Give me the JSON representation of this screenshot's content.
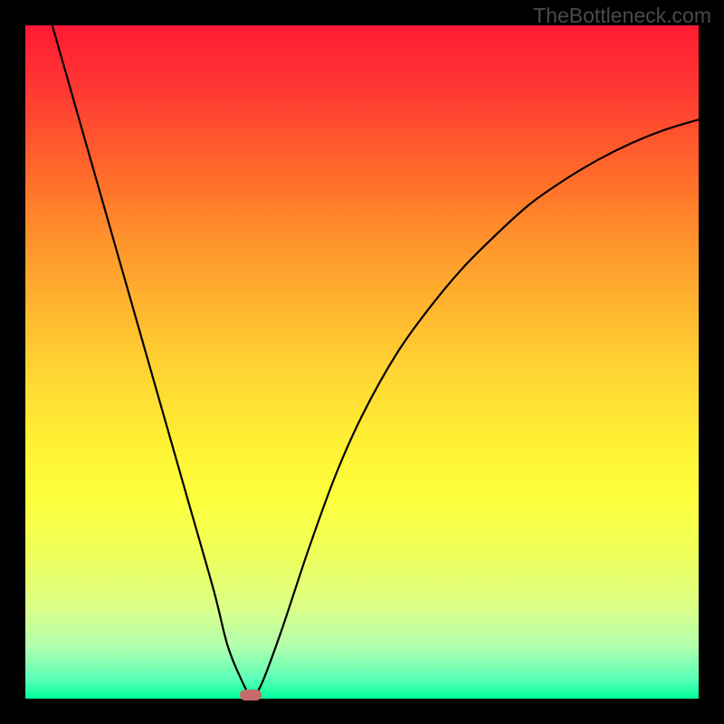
{
  "watermark": "TheBottleneck.com",
  "chart_data": {
    "type": "line",
    "title": "",
    "xlabel": "",
    "ylabel": "",
    "xlim": [
      0,
      100
    ],
    "ylim": [
      0,
      100
    ],
    "series": [
      {
        "name": "curve",
        "x": [
          4,
          8,
          12,
          16,
          20,
          24,
          28,
          30,
          32,
          33.5,
          35,
          38,
          42,
          46,
          50,
          55,
          60,
          65,
          70,
          75,
          80,
          85,
          90,
          95,
          100
        ],
        "y": [
          100,
          86,
          72,
          58,
          44,
          30,
          16,
          8,
          3,
          0.5,
          2,
          10,
          22,
          33,
          42,
          51,
          58,
          64,
          69,
          73.5,
          77,
          80,
          82.5,
          84.5,
          86
        ]
      }
    ],
    "marker": {
      "x": 33.5,
      "y": 0.5
    },
    "gradient_stops": [
      {
        "pos": 0,
        "color": "#ff1a33"
      },
      {
        "pos": 10,
        "color": "#ff3a33"
      },
      {
        "pos": 22,
        "color": "#ff6a2a"
      },
      {
        "pos": 32,
        "color": "#ff932c"
      },
      {
        "pos": 42,
        "color": "#ffb62f"
      },
      {
        "pos": 52,
        "color": "#ffd633"
      },
      {
        "pos": 62,
        "color": "#fff033"
      },
      {
        "pos": 70,
        "color": "#fdff3c"
      },
      {
        "pos": 78,
        "color": "#f0ff58"
      },
      {
        "pos": 86,
        "color": "#ddff85"
      },
      {
        "pos": 92,
        "color": "#b4ffac"
      },
      {
        "pos": 97,
        "color": "#5cffb8"
      },
      {
        "pos": 100,
        "color": "#00ff99"
      }
    ]
  }
}
